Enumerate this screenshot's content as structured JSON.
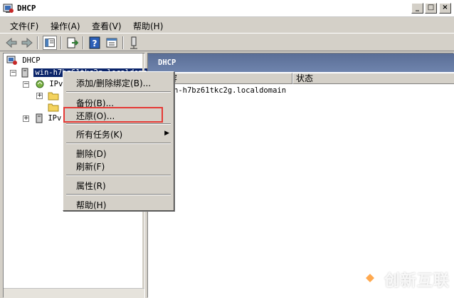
{
  "window": {
    "title": "DHCP",
    "buttons": {
      "minimize": "_",
      "maximize": "□",
      "close": "×"
    }
  },
  "menubar": [
    {
      "label": "文件(F)"
    },
    {
      "label": "操作(A)"
    },
    {
      "label": "查看(V)"
    },
    {
      "label": "帮助(H)"
    }
  ],
  "tree": {
    "root": "DHCP",
    "server": "win-h7bz61tkc2g.localdomain",
    "ipv4": "IPv",
    "ipv6": "IPv"
  },
  "right_panel": {
    "header": "DHCP",
    "columns": [
      "的内容",
      "状态"
    ],
    "rows": [
      "n-h7bz61tkc2g.localdomain"
    ]
  },
  "context_menu": {
    "items": [
      "添加/删除绑定(B)...",
      "备份(B)...",
      "还原(O)...",
      "所有任务(K)",
      "删除(D)",
      "刷新(F)",
      "属性(R)",
      "帮助(H)"
    ],
    "submenu_arrow": "▶"
  },
  "watermark": {
    "text": "创新互联"
  },
  "colors": {
    "title_bar": "#ffffff",
    "window_bg": "#d4d0c8",
    "selection": "#0a246a",
    "panel_header": "#6a7ea6",
    "highlight": "#e53935"
  }
}
